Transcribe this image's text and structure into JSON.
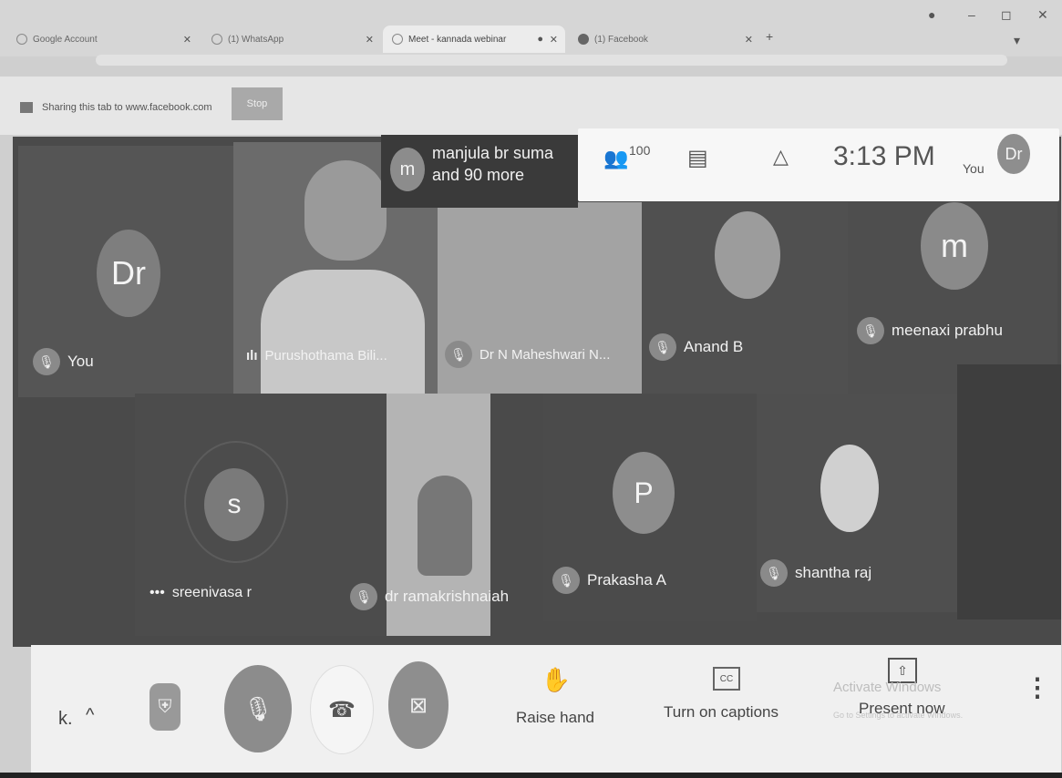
{
  "browser": {
    "tabs": [
      {
        "title": "Google Account"
      },
      {
        "title": "(1) WhatsApp"
      },
      {
        "title": "Meet - kannada webinar"
      },
      {
        "title": "(1) Facebook"
      }
    ],
    "new_tab_label": "+"
  },
  "sharebar": {
    "text": "Sharing this tab to www.facebook.com",
    "stop_label": "Stop"
  },
  "header": {
    "overflow_initial": "m",
    "overflow_text_line1": "manjula br suma",
    "overflow_text_line2": "and 90 more",
    "participant_count": "100",
    "time": "3:13 PM",
    "self_label": "You",
    "self_initials": "Dr"
  },
  "participants": [
    {
      "name": "You",
      "initials": "Dr",
      "muted": true
    },
    {
      "name": "Purushothama Bili...",
      "initials": "",
      "muted": false
    },
    {
      "name": "Dr N Maheshwari N...",
      "initials": "",
      "muted": true
    },
    {
      "name": "Anand B",
      "initials": "",
      "muted": true
    },
    {
      "name": "meenaxi prabhu",
      "initials": "m",
      "muted": true
    },
    {
      "name": "sreenivasa r",
      "initials": "s",
      "muted": false
    },
    {
      "name": "dr ramakrishnaiah",
      "initials": "",
      "muted": true
    },
    {
      "name": "Prakasha A",
      "initials": "P",
      "muted": true
    },
    {
      "name": "shantha raj",
      "initials": "",
      "muted": true
    }
  ],
  "controls": {
    "meeting_code": "k.",
    "raise_hand": "Raise hand",
    "captions": "Turn on captions",
    "present": "Present now",
    "watermark_line1": "Activate Windows",
    "watermark_line2": "Go to Settings to activate Windows."
  },
  "colors": {
    "end_call": "#8e8e8e",
    "muted_button": "#8c8c8c"
  }
}
